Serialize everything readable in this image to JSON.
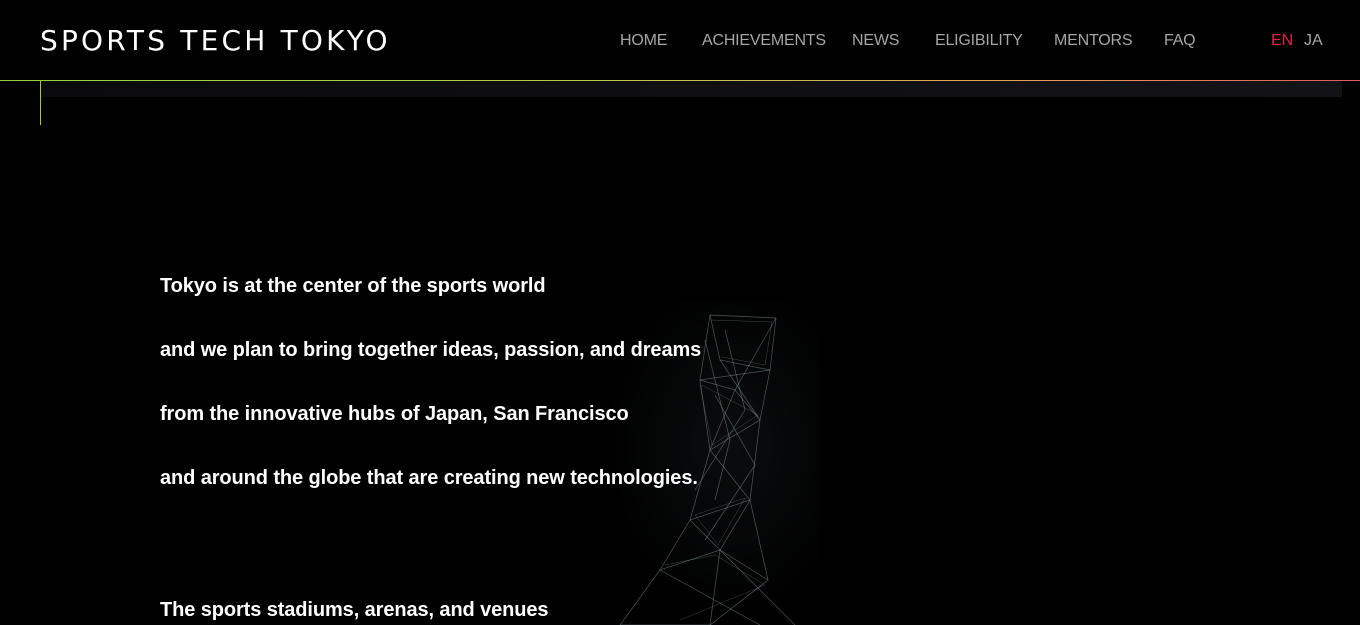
{
  "header": {
    "logo": "SPORTS TECH TOKYO",
    "nav": [
      {
        "label": "HOME"
      },
      {
        "label": "ACHIEVEMENTS"
      },
      {
        "label": "NEWS"
      },
      {
        "label": "ELIGIBILITY"
      },
      {
        "label": "MENTORS"
      },
      {
        "label": "FAQ"
      }
    ],
    "languages": {
      "active": "EN",
      "other": "JA"
    }
  },
  "colors": {
    "background": "#000000",
    "nav_text": "#a6a6a6",
    "active_language": "#e0224a",
    "accent_green": "#8fd43a",
    "accent_red": "#e05a5a"
  },
  "main": {
    "intro_lines": [
      "Tokyo is at the center of the sports world",
      "and we plan to bring together ideas, passion, and dreams",
      "from the innovative hubs of Japan, San Francisco",
      "and around the globe that are creating new technologies."
    ],
    "second_paragraph_lines": [
      "The sports stadiums, arenas, and venues"
    ]
  },
  "icons": {
    "background_art": "wireframe-tower-graphic"
  }
}
